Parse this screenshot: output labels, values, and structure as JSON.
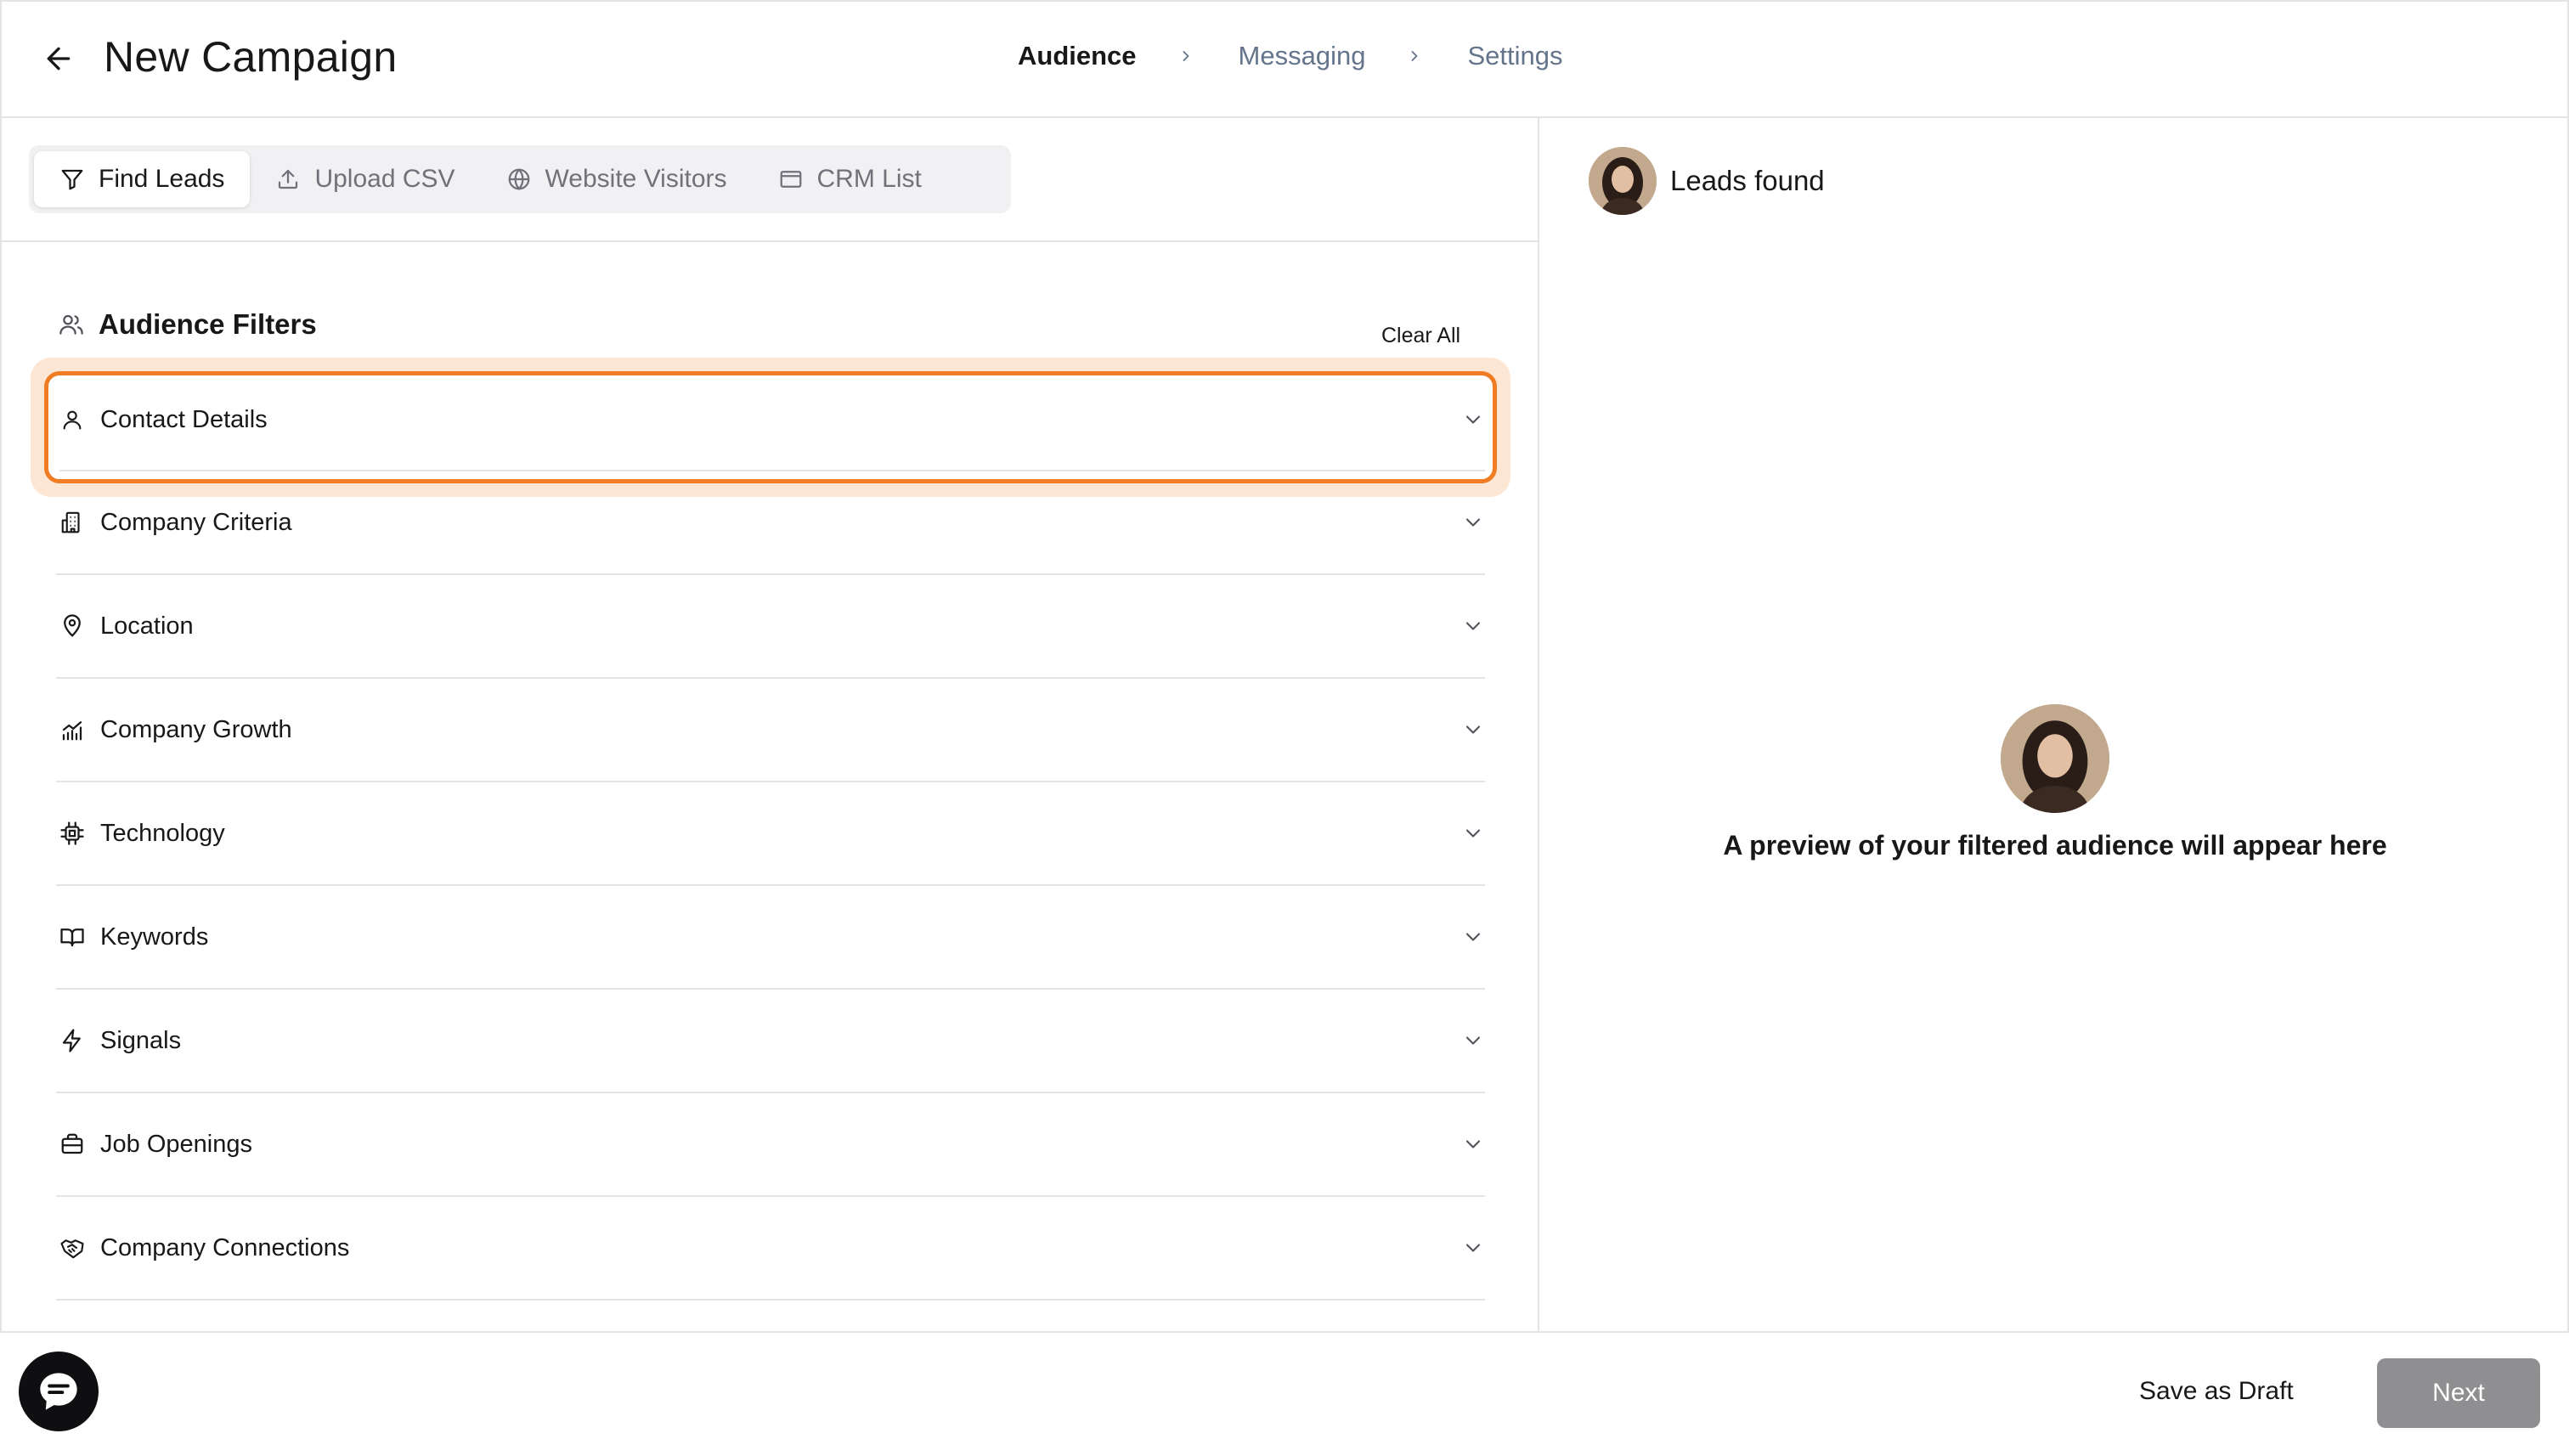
{
  "header": {
    "title": "New Campaign",
    "steps": [
      {
        "label": "Audience",
        "active": true
      },
      {
        "label": "Messaging",
        "active": false
      },
      {
        "label": "Settings",
        "active": false
      }
    ]
  },
  "tabs": [
    {
      "label": "Find Leads",
      "icon": "filter-icon",
      "active": true
    },
    {
      "label": "Upload CSV",
      "icon": "upload-icon",
      "active": false
    },
    {
      "label": "Website Visitors",
      "icon": "globe-icon",
      "active": false
    },
    {
      "label": "CRM List",
      "icon": "browser-window-icon",
      "active": false
    }
  ],
  "filters": {
    "title": "Audience Filters",
    "clear_all": "Clear All",
    "items": [
      {
        "label": "Contact Details",
        "icon": "user-icon",
        "highlighted": true
      },
      {
        "label": "Company Criteria",
        "icon": "building-icon"
      },
      {
        "label": "Location",
        "icon": "map-pin-icon"
      },
      {
        "label": "Company Growth",
        "icon": "growth-chart-icon"
      },
      {
        "label": "Technology",
        "icon": "chip-icon"
      },
      {
        "label": "Keywords",
        "icon": "book-icon"
      },
      {
        "label": "Signals",
        "icon": "lightning-icon"
      },
      {
        "label": "Job Openings",
        "icon": "briefcase-icon"
      },
      {
        "label": "Company Connections",
        "icon": "handshake-icon"
      }
    ]
  },
  "preview": {
    "leads_found": "Leads found",
    "message": "A preview of your filtered audience will appear here"
  },
  "footer": {
    "save_draft": "Save as Draft",
    "next": "Next"
  },
  "colors": {
    "highlight_border": "#f07c24",
    "highlight_glow": "#fde6d3",
    "next_button": "#8f8f91",
    "chat_button": "#0f0f12"
  }
}
